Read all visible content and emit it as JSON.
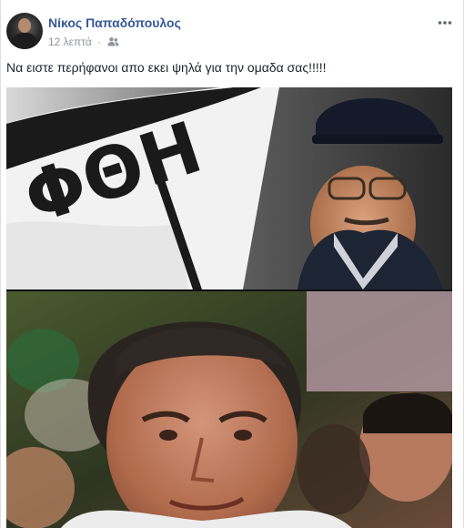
{
  "post": {
    "author": "Νίκος Παπαδόπουλος",
    "timestamp": "12 λεπτά",
    "separator": "·",
    "privacy_icon": "friends-icon",
    "more_icon": "more-horizontal-icon",
    "message": "Να ειστε περήφανοι απο εκει ψηλά για την ομαδα σας!!!!!",
    "photo": {
      "top_panel_flag_text": "ΦΘΗ",
      "colors": {
        "author_link": "#365899",
        "meta_gray": "#90949c",
        "flag_black": "#1a1a1a",
        "flag_white": "#f4f4f4"
      }
    }
  }
}
